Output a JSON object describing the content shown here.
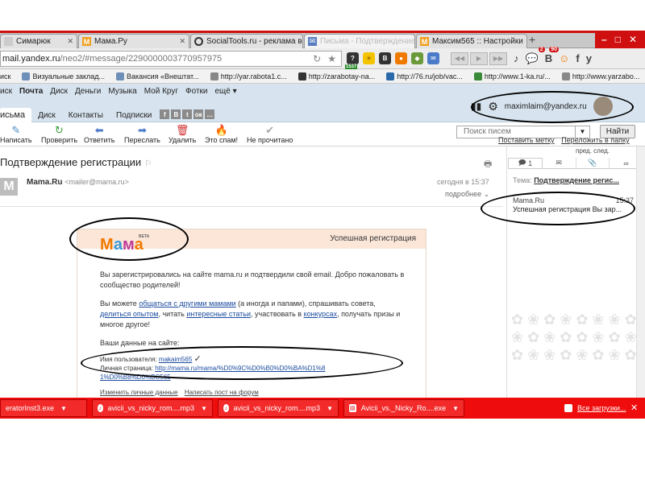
{
  "tabs": [
    {
      "label": "Симарюк",
      "icon": "page-icon"
    },
    {
      "label": "Мама.Ру",
      "icon": "mama-icon"
    },
    {
      "label": "SocialTools.ru - реклама в",
      "icon": "socialtools-icon"
    },
    {
      "label": "Письма - Подтверждение",
      "icon": "mail-icon"
    },
    {
      "label": "Максим565 :: Настройки",
      "icon": "mama-icon"
    }
  ],
  "address": {
    "host": "mail.yandex.ru",
    "path": "/neo2/#message/2290000003770957975"
  },
  "toolbar_badges": {
    "counter_1": "1537",
    "counter_2": "2",
    "counter_3": "90"
  },
  "bookmarks": [
    "иск",
    "Визуальные заклад...",
    "Вакансия «Внештат...",
    "http://yar.rabota1.c...",
    "http://zarabotay-na...",
    "http://76.ru/job/vac...",
    "http://www.1-ka.ru/...",
    "http://www.yarzabo..."
  ],
  "yandex_nav": [
    "иск",
    "Почта",
    "Диск",
    "Деньги",
    "Музыка",
    "Мой Круг",
    "Фотки",
    "ещё"
  ],
  "mail_tabs": [
    "исьма",
    "Диск",
    "Контакты",
    "Подписки"
  ],
  "share_icons": [
    "f",
    "В",
    "t",
    "ок",
    "…"
  ],
  "user_email": "maximlaim@yandex.ru",
  "actions": [
    "Написать",
    "Проверить",
    "Ответить",
    "Переслать",
    "Удалить",
    "Это спам!",
    "Не прочитано"
  ],
  "search": {
    "placeholder": "Поиск писем",
    "button": "Найти"
  },
  "toolbar_links": [
    "Поставить метку",
    "Переложить в папку"
  ],
  "message": {
    "title": "Подтверждение регистрации",
    "sender_name": "Mama.Ru",
    "sender_addr": "<mailer@mama.ru>",
    "date": "сегодня в 15:37",
    "details": "подробнее"
  },
  "card": {
    "logo_text": "Мама",
    "logo_beta": "BETA",
    "status": "Успешная регистрация",
    "para1": "Вы зарегистрировались на сайте mama.ru и подтвердили свой email. Добро пожаловать в сообщество родителей!",
    "p2_a": "Вы можете ",
    "p2_link1": "общаться с другими мамами",
    "p2_b": " (а иногда и папами), спрашивать совета, ",
    "p2_link2": "делиться опытом",
    "p2_c": ", читать ",
    "p2_link3": "интересные статьи",
    "p2_d": ", участвовать в ",
    "p2_link4": "конкурсах",
    "p2_e": ", получать призы и многое другое!",
    "data_heading": "Ваши данные на сайте:",
    "user_label": "Имя пользователя: ",
    "user_value": "makaim565",
    "page_label": "Личная страница: ",
    "page_value": "http://mama.ru/mama/%D0%9C%D0%B0%D0%BA%D1%81%D0%B8%D0%BC565",
    "foot_link1": "Изменить личные данные",
    "foot_link2": "Написать пост на форум"
  },
  "right_panel": {
    "nav": "пред.  след.",
    "tab_count": "1",
    "topic_label": "Тема: ",
    "topic_value": "Подтверждение регис...",
    "item_from": "Mama.Ru",
    "item_time": "15:37",
    "item_subject": "Успешная регистрация Вы зар..."
  },
  "downloads": [
    {
      "name": "eratorInst3.exe",
      "icon": "exe-icon"
    },
    {
      "name": "avicii_vs_nicky_rom....mp3",
      "icon": "mp3-icon"
    },
    {
      "name": "avicii_vs_nicky_rom....mp3",
      "icon": "mp3-icon"
    },
    {
      "name": "Avicii_vs._Nicky_Ro....exe",
      "icon": "exe-icon"
    }
  ],
  "downloads_all": "Все загрузки..."
}
